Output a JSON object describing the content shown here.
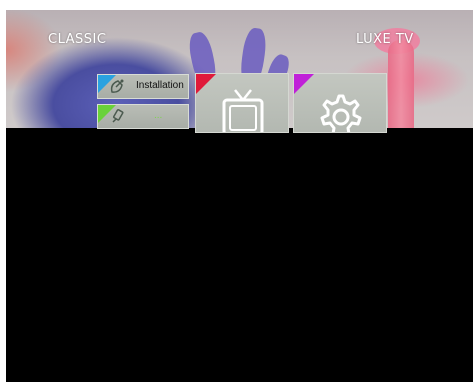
{
  "brand": {
    "left": "CLASSIC",
    "right": "LUXE TV"
  },
  "menu": {
    "items": [
      {
        "label": "Installation",
        "icon": "satellite-dish-icon",
        "accent": "#2aa2e0"
      },
      {
        "label": "...",
        "icon": "usb-icon",
        "accent": "#6ad23a"
      }
    ]
  },
  "tiles": [
    {
      "icon": "tv-icon",
      "accent": "#e01a3a"
    },
    {
      "icon": "gear-icon",
      "accent": "#c020d8"
    }
  ]
}
